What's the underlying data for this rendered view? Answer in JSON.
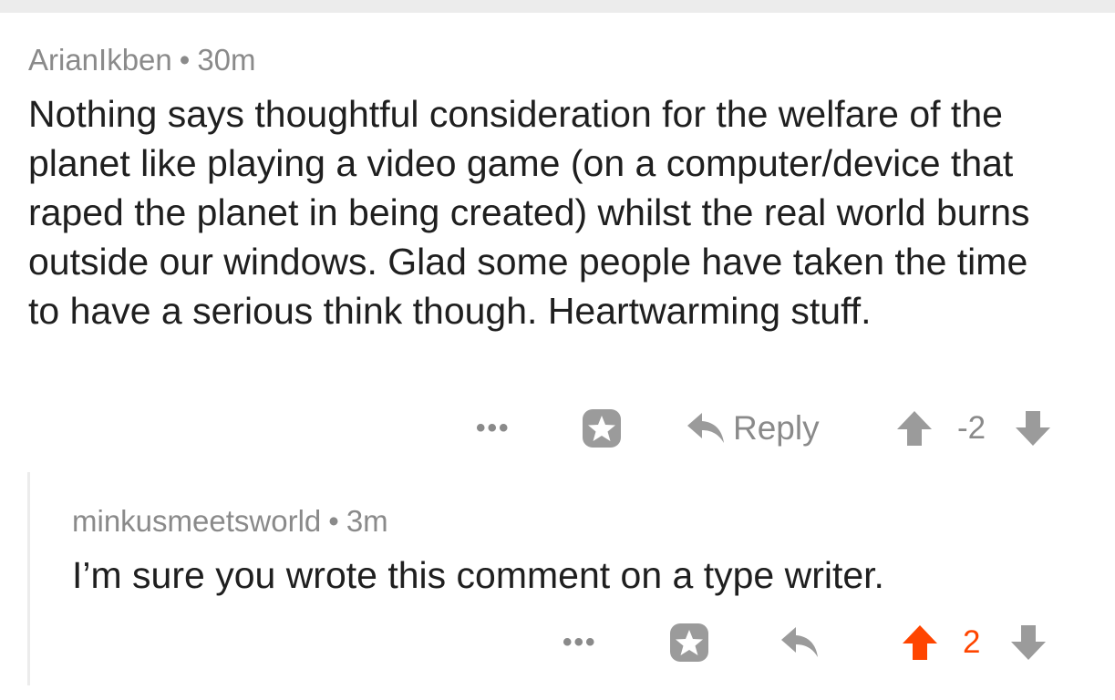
{
  "comments": [
    {
      "author": "ArianIkben",
      "separator": "•",
      "time": "30m",
      "body": "Nothing says thoughtful consideration for the welfare of the planet like playing a video game (on a computer/device that raped the planet in being created) whilst the real world burns outside our windows. Glad some people have taken the time to have a serious think though. Heartwarming stuff.",
      "more_label": "•••",
      "reply_label": "Reply",
      "score": "-2",
      "vote_state": "none",
      "icons": [
        "more-icon",
        "save-star-icon",
        "reply-arrow-icon",
        "upvote-arrow-icon",
        "downvote-arrow-icon"
      ]
    },
    {
      "author": "minkusmeetsworld",
      "separator": "•",
      "time": "3m",
      "body": "I’m sure you wrote this comment on a type writer.",
      "more_label": "•••",
      "score": "2",
      "vote_state": "upvoted",
      "icons": [
        "more-icon",
        "save-star-icon",
        "reply-arrow-icon",
        "upvote-arrow-icon",
        "downvote-arrow-icon"
      ]
    }
  ],
  "colors": {
    "muted": "#8a8a8a",
    "text": "#1f1f1f",
    "upvote": "#ff4500",
    "icon": "#9b9b9b",
    "divider": "#ececec"
  }
}
